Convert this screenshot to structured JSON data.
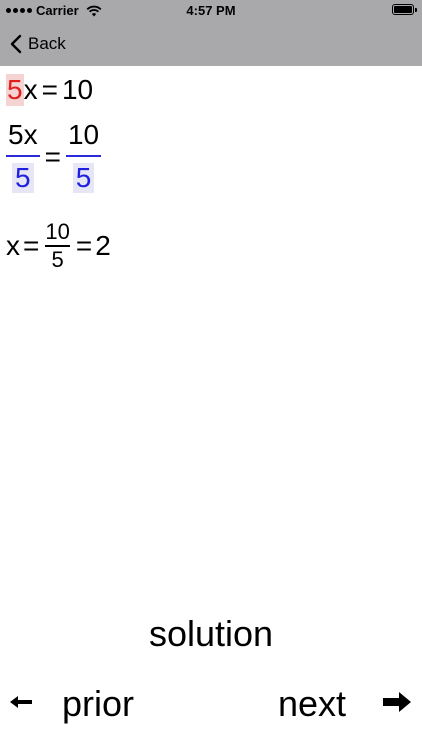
{
  "status": {
    "carrier": "Carrier",
    "time": "4:57 PM"
  },
  "nav": {
    "back_label": "Back"
  },
  "equation": {
    "line1": {
      "coef": "5",
      "var": "x",
      "eq": "=",
      "rhs": "10"
    },
    "line2": {
      "num_left": "5x",
      "den_left": "5",
      "eq": "=",
      "num_right": "10",
      "den_right": "5"
    },
    "line3": {
      "var": "x",
      "eq1": "=",
      "num": "10",
      "den": "5",
      "eq2": "=",
      "result": "2"
    }
  },
  "controls": {
    "solution": "solution",
    "prior": "prior",
    "next": "next"
  },
  "icons": {
    "prior_arrow": "left-arrow-icon",
    "next_arrow": "right-arrow-icon"
  },
  "colors": {
    "highlight_red": "#e0201e",
    "highlight_blue": "#2020e0",
    "bar_gray": "#a9a9ac"
  }
}
